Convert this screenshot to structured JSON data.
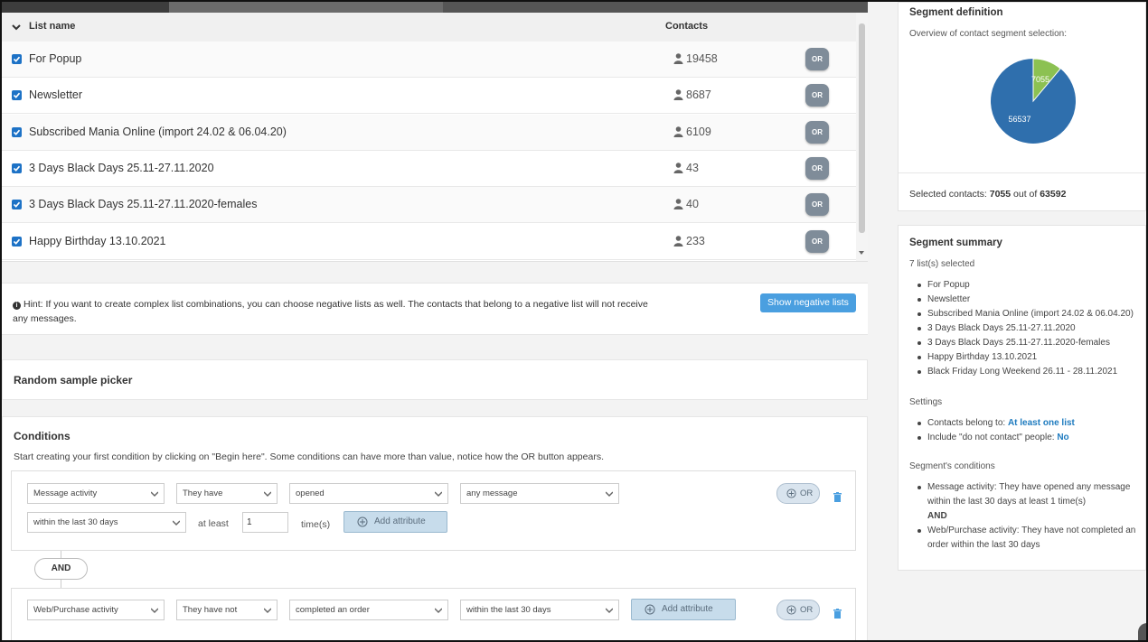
{
  "list_table": {
    "col_name": "List name",
    "col_contacts": "Contacts",
    "or_label": "OR",
    "rows": [
      {
        "name": "For Popup",
        "contacts": "19458"
      },
      {
        "name": "Newsletter",
        "contacts": "8687"
      },
      {
        "name": "Subscribed Mania Online (import 24.02 & 06.04.20)",
        "contacts": "6109"
      },
      {
        "name": "3 Days Black Days 25.11-27.11.2020",
        "contacts": "43"
      },
      {
        "name": "3 Days Black Days 25.11-27.11.2020-females",
        "contacts": "40"
      },
      {
        "name": "Happy Birthday 13.10.2021",
        "contacts": "233"
      }
    ]
  },
  "hint": {
    "text": "Hint: If you want to create complex list combinations, you can choose negative lists as well. The contacts that belong to a negative list will not receive any messages.",
    "button": "Show negative lists"
  },
  "random_sample": {
    "title": "Random sample picker"
  },
  "conditions": {
    "title": "Conditions",
    "subtitle": "Start creating your first condition by clicking on \"Begin here\". Some conditions can have more than value, notice how the OR button appears.",
    "and_label": "AND",
    "add_attribute": "Add attribute",
    "or_label": "OR",
    "block1": {
      "type": "Message activity",
      "verb": "They have",
      "action": "opened",
      "target": "any message",
      "period": "within the last 30 days",
      "at_least": "at least",
      "times_value": "1",
      "times_label": "time(s)"
    },
    "block2": {
      "type": "Web/Purchase activity",
      "verb": "They have not",
      "action": "completed an order",
      "period": "within the last 30 days"
    }
  },
  "segment_definition": {
    "title": "Segment definition",
    "subtitle": "Overview of contact segment selection:",
    "pie": {
      "selected": 7055,
      "rest": 56537,
      "selected_label": "7055",
      "rest_label": "56537",
      "selected_color": "#8cc152",
      "rest_color": "#2f6fad"
    },
    "selected_prefix": "Selected contacts:",
    "selected_value": "7055",
    "out_of": "out of",
    "total_value": "63592"
  },
  "segment_summary": {
    "title": "Segment summary",
    "lists_selected": "7 list(s) selected",
    "lists": [
      "For Popup",
      "Newsletter",
      "Subscribed Mania Online (import 24.02 & 06.04.20)",
      "3 Days Black Days 25.11-27.11.2020",
      "3 Days Black Days 25.11-27.11.2020-females",
      "Happy Birthday 13.10.2021",
      "Black Friday Long Weekend 26.11 - 28.11.2021"
    ],
    "settings_title": "Settings",
    "belong_label": "Contacts belong to:",
    "belong_value": "At least one list",
    "include_label": "Include \"do not contact\" people:",
    "include_value": "No",
    "conditions_title": "Segment's conditions",
    "cond1": "Message activity: They have opened any message within the last 30 days at least 1 time(s)",
    "cond_and": "AND",
    "cond2": "Web/Purchase activity: They have not completed an order within the last 30 days"
  }
}
